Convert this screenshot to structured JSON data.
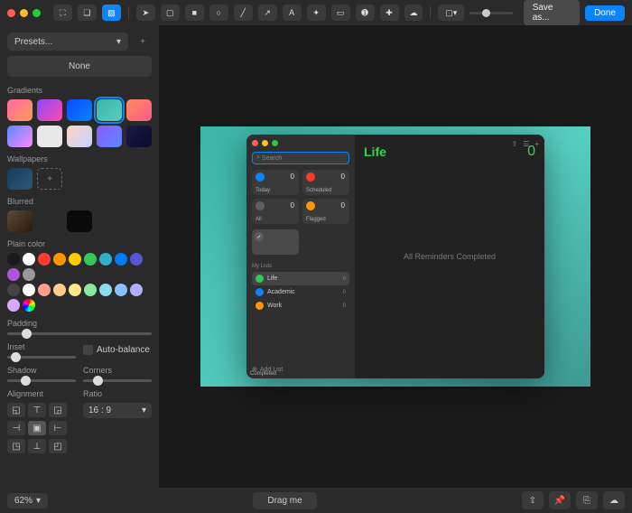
{
  "topbar": {
    "save_as": "Save as...",
    "done": "Done"
  },
  "sidebar": {
    "presets_label": "Presets...",
    "none_label": "None",
    "gradients_label": "Gradients",
    "wallpapers_label": "Wallpapers",
    "blurred_label": "Blurred",
    "plain_color_label": "Plain color",
    "padding_label": "Padding",
    "inset_label": "Inset",
    "auto_balance_label": "Auto-balance",
    "shadow_label": "Shadow",
    "corners_label": "Corners",
    "alignment_label": "Alignment",
    "ratio_label": "Ratio",
    "ratio_value": "16 : 9",
    "gradients": [
      "linear-gradient(135deg,#ff6a9e,#ff9a5a)",
      "linear-gradient(135deg,#8a4aff,#ff4aa8)",
      "linear-gradient(135deg,#0a4aff,#0a84ff)",
      "linear-gradient(135deg,#3ab5a8,#56cfc2)",
      "linear-gradient(135deg,#ff8a5a,#ff5a8a)",
      "linear-gradient(135deg,#5a8aff,#ff8aff)",
      "#e8e8e8",
      "linear-gradient(135deg,#ffd4c4,#c4d4ff)",
      "linear-gradient(135deg,#8a5aff,#5a8aff)",
      "linear-gradient(135deg,#1a1a4a,#0a0a2a)"
    ],
    "blurred_colors": [
      "linear-gradient(135deg,#5a4a3a,#2a1a0a)",
      "#2a2a2a",
      "#0a0a0a"
    ],
    "plain_colors_row1": [
      "#1a1a1a",
      "#fff",
      "#ff3b30",
      "#ff9500",
      "#ffcc00",
      "#34c759",
      "#30b0c7",
      "#007aff",
      "#5856d6",
      "#af52de",
      "#999"
    ],
    "plain_colors_row2": [
      "#444",
      "#fff",
      "#ff9e8a",
      "#ffcc8a",
      "#ffe88a",
      "#8ae89e",
      "#8addee",
      "#8abfff",
      "#b0aeff",
      "#d8a8ff",
      "conic-gradient(red,yellow,lime,cyan,blue,magenta,red)"
    ]
  },
  "reminders": {
    "search_placeholder": "Search",
    "title": "Life",
    "main_count": "0",
    "cards": [
      {
        "label": "Today",
        "count": "0",
        "icon_color": "#0a84ff"
      },
      {
        "label": "Scheduled",
        "count": "0",
        "icon_color": "#ff3b30"
      },
      {
        "label": "All",
        "count": "0",
        "icon_color": "#5e5e5e"
      },
      {
        "label": "Flagged",
        "count": "0",
        "icon_color": "#ff9500"
      }
    ],
    "completed_label": "Completed",
    "my_lists_label": "My Lists",
    "lists": [
      {
        "name": "Life",
        "count": "0",
        "color": "#34c759",
        "selected": true
      },
      {
        "name": "Academic",
        "count": "0",
        "color": "#0a84ff",
        "selected": false
      },
      {
        "name": "Work",
        "count": "0",
        "color": "#ff9500",
        "selected": false
      }
    ],
    "add_list_label": "Add List",
    "empty_message": "All Reminders Completed"
  },
  "bottombar": {
    "zoom": "62%",
    "drag_label": "Drag me"
  }
}
